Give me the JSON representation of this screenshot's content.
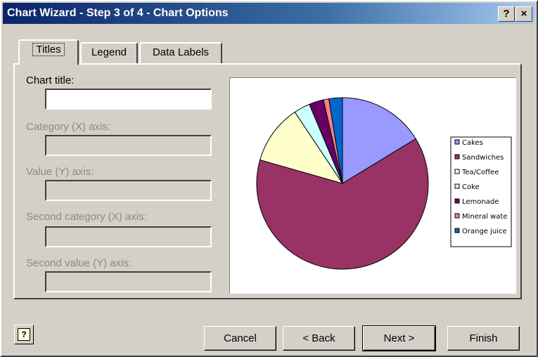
{
  "window": {
    "title": "Chart Wizard - Step 3 of 4 - Chart Options",
    "help_glyph": "?",
    "close_glyph": "×"
  },
  "tabs": [
    {
      "label": "Titles",
      "active": true
    },
    {
      "label": "Legend",
      "active": false
    },
    {
      "label": "Data Labels",
      "active": false
    }
  ],
  "fields": {
    "chart_title": {
      "label": "Chart title:",
      "value": ""
    },
    "category_x": {
      "label": "Category (X) axis:",
      "value": ""
    },
    "value_y": {
      "label": "Value (Y) axis:",
      "value": ""
    },
    "second_category_x": {
      "label": "Second category (X) axis:",
      "value": ""
    },
    "second_value_y": {
      "label": "Second value (Y) axis:",
      "value": ""
    }
  },
  "buttons": {
    "help": "?",
    "cancel": "Cancel",
    "back": "< Back",
    "next": "Next >",
    "finish": "Finish"
  },
  "chart_data": {
    "type": "pie",
    "categories": [
      "Cakes",
      "Sandwiches",
      "Tea/Coffee",
      "Coke",
      "Lemonade",
      "Mineral wate",
      "Orange juice"
    ],
    "values": [
      16,
      62,
      11,
      3,
      2.7,
      1,
      2.5
    ],
    "colors": [
      "#9999ff",
      "#993366",
      "#ffffcc",
      "#ccffff",
      "#660066",
      "#ff8080",
      "#0066cc"
    ],
    "legend_position": "right"
  }
}
